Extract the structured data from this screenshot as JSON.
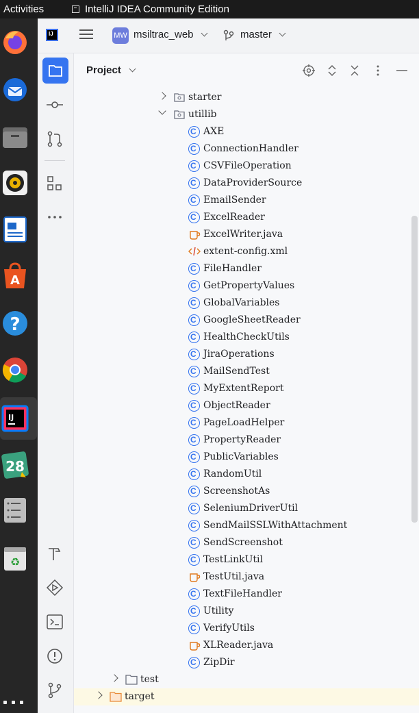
{
  "system": {
    "activities": "Activities",
    "window_title": "IntelliJ IDEA Community Edition"
  },
  "dock": {
    "apps": [
      {
        "name": "firefox-icon"
      },
      {
        "name": "thunderbird-icon"
      },
      {
        "name": "files-icon"
      },
      {
        "name": "rhythmbox-icon"
      },
      {
        "name": "libreoffice-writer-icon"
      },
      {
        "name": "app-center-icon"
      },
      {
        "name": "help-icon",
        "label": "?"
      },
      {
        "name": "chrome-icon"
      },
      {
        "name": "intellij-icon",
        "label": "IJ"
      },
      {
        "name": "calendar-icon",
        "label": "28"
      },
      {
        "name": "text-editor-icon"
      },
      {
        "name": "trash-icon"
      }
    ]
  },
  "mainbar": {
    "project_badge": "MW",
    "project_name": "msiltrac_web",
    "branch": "master"
  },
  "panel": {
    "title": "Project"
  },
  "tree": [
    {
      "label": "starter",
      "type": "folder-pkg",
      "depth": 3,
      "expanded": false
    },
    {
      "label": "utillib",
      "type": "folder-pkg",
      "depth": 3,
      "expanded": true
    },
    {
      "label": "AXE",
      "type": "class"
    },
    {
      "label": "ConnectionHandler",
      "type": "class"
    },
    {
      "label": "CSVFileOperation",
      "type": "class"
    },
    {
      "label": "DataProviderSource",
      "type": "class"
    },
    {
      "label": "EmailSender",
      "type": "class"
    },
    {
      "label": "ExcelReader",
      "type": "class"
    },
    {
      "label": "ExcelWriter.java",
      "type": "java"
    },
    {
      "label": "extent-config.xml",
      "type": "xml"
    },
    {
      "label": "FileHandler",
      "type": "class"
    },
    {
      "label": "GetPropertyValues",
      "type": "class"
    },
    {
      "label": "GlobalVariables",
      "type": "class"
    },
    {
      "label": "GoogleSheetReader",
      "type": "class"
    },
    {
      "label": "HealthCheckUtils",
      "type": "class"
    },
    {
      "label": "JiraOperations",
      "type": "class"
    },
    {
      "label": "MailSendTest",
      "type": "class"
    },
    {
      "label": "MyExtentReport",
      "type": "class"
    },
    {
      "label": "ObjectReader",
      "type": "class"
    },
    {
      "label": "PageLoadHelper",
      "type": "class"
    },
    {
      "label": "PropertyReader",
      "type": "class"
    },
    {
      "label": "PublicVariables",
      "type": "class"
    },
    {
      "label": "RandomUtil",
      "type": "class"
    },
    {
      "label": "ScreenshotAs",
      "type": "class"
    },
    {
      "label": "SeleniumDriverUtil",
      "type": "class"
    },
    {
      "label": "SendMailSSLWithAttachment",
      "type": "class"
    },
    {
      "label": "SendScreenshot",
      "type": "class"
    },
    {
      "label": "TestLinkUtil",
      "type": "class"
    },
    {
      "label": "TestUtil.java",
      "type": "java"
    },
    {
      "label": "TextFileHandler",
      "type": "class"
    },
    {
      "label": "Utility",
      "type": "class"
    },
    {
      "label": "VerifyUtils",
      "type": "class"
    },
    {
      "label": "XLReader.java",
      "type": "java"
    },
    {
      "label": "ZipDir",
      "type": "class"
    },
    {
      "label": "test",
      "type": "folder",
      "depth": 1,
      "expanded": false
    },
    {
      "label": "target",
      "type": "folder-orange",
      "depth": 0,
      "expanded": false
    }
  ]
}
